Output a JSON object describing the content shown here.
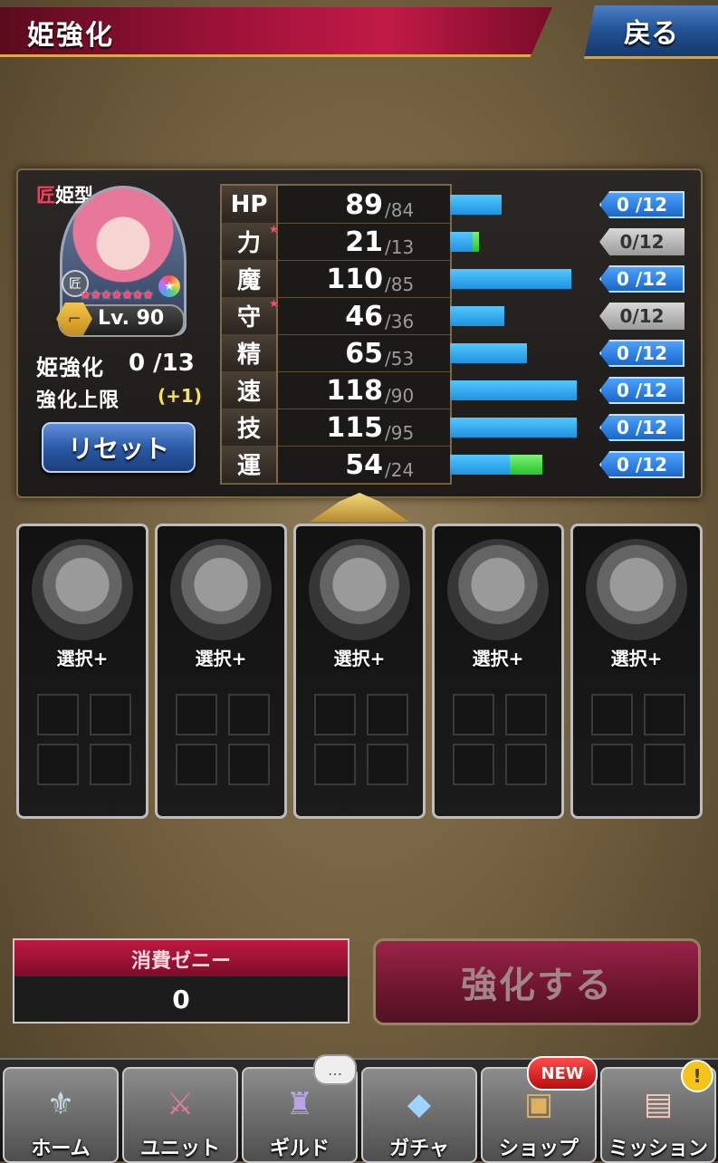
{
  "header": {
    "title": "姫強化",
    "back_label": "戻る"
  },
  "character": {
    "type_prefix": "匠",
    "type_suffix": "姫型",
    "craft_badge": "匠",
    "rarity_stars": "★★★★★★★",
    "level_label": "Lv. 90",
    "enhance_label": "姫強化",
    "enhance_value": "0 /13",
    "limit_label": "強化上限",
    "limit_value": "(+1)",
    "reset_label": "リセット"
  },
  "stats": [
    {
      "name": "HP",
      "value": "89",
      "base": "/84",
      "bar": 0.41,
      "extra": 0,
      "points": "0 /12",
      "pill": "blue",
      "star": false
    },
    {
      "name": "力",
      "value": "21",
      "base": "/13",
      "bar": 0.18,
      "extra": 0.05,
      "points": "0/12",
      "pill": "gray",
      "star": true
    },
    {
      "name": "魔",
      "value": "110",
      "base": "/85",
      "bar": 0.96,
      "extra": 0,
      "points": "0 /12",
      "pill": "blue",
      "star": false
    },
    {
      "name": "守",
      "value": "46",
      "base": "/36",
      "bar": 0.43,
      "extra": 0,
      "points": "0/12",
      "pill": "gray",
      "star": true
    },
    {
      "name": "精",
      "value": "65",
      "base": "/53",
      "bar": 0.61,
      "extra": 0,
      "points": "0 /12",
      "pill": "blue",
      "star": false
    },
    {
      "name": "速",
      "value": "118",
      "base": "/90",
      "bar": 1.0,
      "extra": 0,
      "points": "0 /12",
      "pill": "blue",
      "star": false
    },
    {
      "name": "技",
      "value": "115",
      "base": "/95",
      "bar": 1.0,
      "extra": 0,
      "points": "0 /12",
      "pill": "blue",
      "star": false
    },
    {
      "name": "運",
      "value": "54",
      "base": "/24",
      "bar": 0.47,
      "extra": 0.26,
      "points": "0 /12",
      "pill": "blue",
      "star": false
    }
  ],
  "slots": [
    {
      "label": "選択+"
    },
    {
      "label": "選択+"
    },
    {
      "label": "選択+"
    },
    {
      "label": "選択+"
    },
    {
      "label": "選択+"
    }
  ],
  "cost": {
    "label": "消費ゼニー",
    "value": "0"
  },
  "action": {
    "enhance_label": "強化する"
  },
  "nav": [
    {
      "label": "ホーム",
      "icon": "crest-icon",
      "glyph": "⚜",
      "color": "#c8d8e0"
    },
    {
      "label": "ユニット",
      "icon": "crossed-swords-icon",
      "glyph": "⚔",
      "color": "#e27aa0"
    },
    {
      "label": "ギルド",
      "icon": "castle-icon",
      "glyph": "♜",
      "color": "#b9a3e8"
    },
    {
      "label": "ガチャ",
      "icon": "crystal-icon",
      "glyph": "◆",
      "color": "#9fd3ff"
    },
    {
      "label": "ショップ",
      "icon": "shop-sign-icon",
      "glyph": "▣",
      "color": "#e0b15a"
    },
    {
      "label": "ミッション",
      "icon": "scroll-icon",
      "glyph": "▤",
      "color": "#f2c9b8"
    }
  ],
  "badges": {
    "new": "NEW",
    "alert": "!",
    "chat": "…"
  }
}
